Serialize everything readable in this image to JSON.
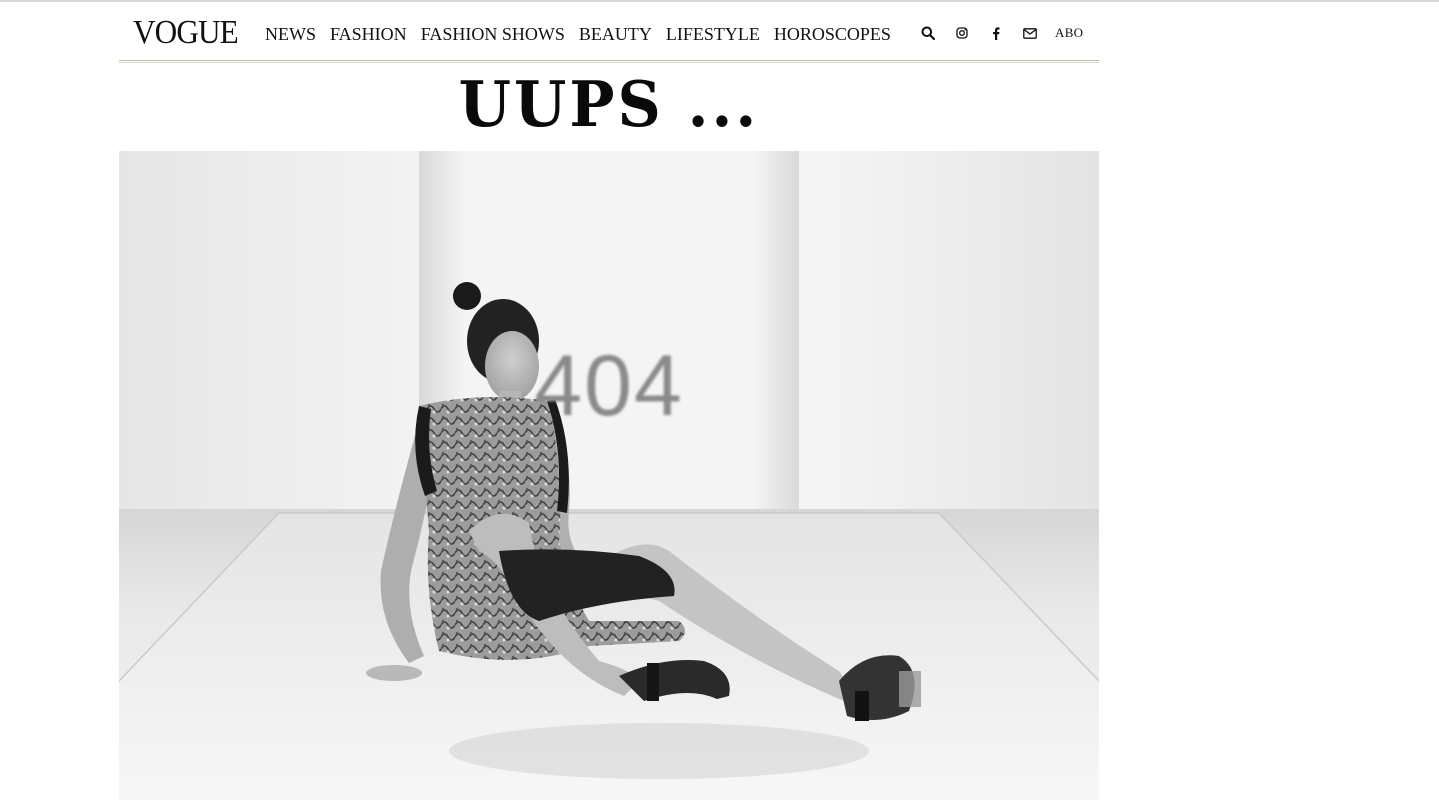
{
  "header": {
    "logo": "VOGUE",
    "nav": [
      "NEWS",
      "FASHION",
      "FASHION SHOWS",
      "BEAUTY",
      "LIFESTYLE",
      "HOROSCOPES"
    ],
    "icons": [
      "search-icon",
      "instagram-icon",
      "facebook-icon",
      "mail-icon"
    ],
    "abo_label": "ABO"
  },
  "main": {
    "title": "UUPS ...",
    "hero": {
      "error_code": "404",
      "description": "runway-fall-photo"
    }
  }
}
